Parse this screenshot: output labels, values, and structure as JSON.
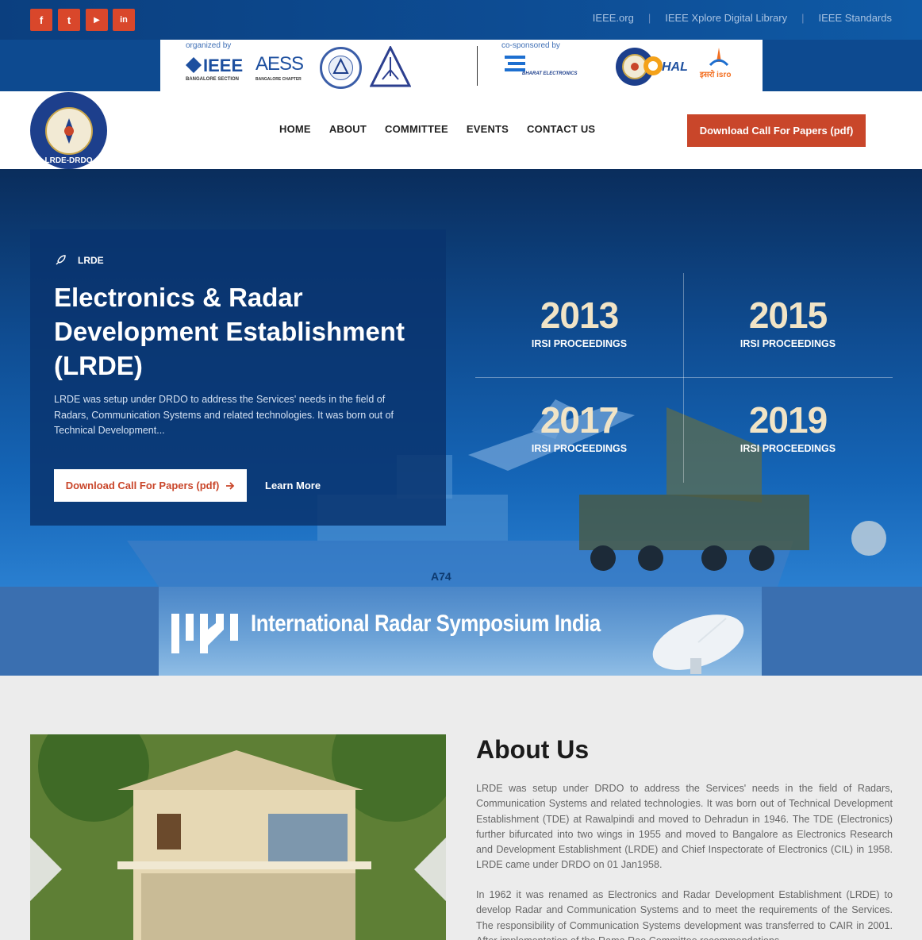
{
  "topbar": {
    "social": [
      {
        "name": "facebook-icon",
        "glyph": "f"
      },
      {
        "name": "twitter-icon",
        "glyph": "t"
      },
      {
        "name": "youtube-icon",
        "glyph": "▶"
      },
      {
        "name": "linkedin-icon",
        "glyph": "in"
      }
    ],
    "links": [
      "IEEE.org",
      "IEEE Xplore Digital Library",
      "IEEE Standards"
    ]
  },
  "sponsors": {
    "organized_caption": "organized by",
    "cosponsored_caption": "co-sponsored by",
    "ieee": "IEEE",
    "ieee_sub": "BANGALORE SECTION",
    "aess": "AESS",
    "aess_sub": "BANGALORE CHAPTER",
    "bel_sub": "BHARAT ELECTRONICS",
    "hal": "HAL",
    "isro": "इसरो isro"
  },
  "nav": {
    "logo_label": "LRDE-DRDO",
    "items": [
      "HOME",
      "ABOUT",
      "COMMITTEE",
      "EVENTS",
      "CONTACT US"
    ],
    "cta": "Download Call For Papers (pdf)"
  },
  "hero": {
    "tag": "LRDE",
    "title": "Electronics & Radar Development Establishment (LRDE)",
    "description": "LRDE was setup under DRDO to address the Services' needs in the field of Radars, Communication Systems and related technologies. It was born out of Technical Development...",
    "primary_button": "Download Call For Papers (pdf)",
    "secondary_button": "Learn More",
    "ship_number": "A74",
    "stats": [
      {
        "year": "2013",
        "label": "IRSI PROCEEDINGS"
      },
      {
        "year": "2015",
        "label": "IRSI PROCEEDINGS"
      },
      {
        "year": "2017",
        "label": "IRSI PROCEEDINGS"
      },
      {
        "year": "2019",
        "label": "IRSI PROCEEDINGS"
      }
    ]
  },
  "banner": {
    "title": "International Radar Symposium India"
  },
  "about": {
    "title": "About Us",
    "paragraph1": "LRDE was setup under DRDO to address the Services' needs in the field of Radars, Communication Systems and related technologies. It was born out of Technical Development Establishment (TDE) at Rawalpindi and moved to Dehradun in 1946. The TDE (Electronics) further bifurcated into two wings in 1955 and moved to Bangalore as Electronics Research and Development Establishment (LRDE) and Chief Inspectorate of Electronics (CIL) in 1958. LRDE came under DRDO on 01 Jan1958.",
    "paragraph2": "In 1962 it was renamed as Electronics and Radar Development Establishment (LRDE) to develop Radar and Communication Systems and to meet the requirements of the Services. The responsibility of Communication Systems development was transferred to CAIR in 2001. After implementation of the Rama Rao Committee recommendations,"
  },
  "colors": {
    "accent": "#c9462a",
    "navy": "#0d4a90",
    "stat_year": "#f1e4c6"
  }
}
